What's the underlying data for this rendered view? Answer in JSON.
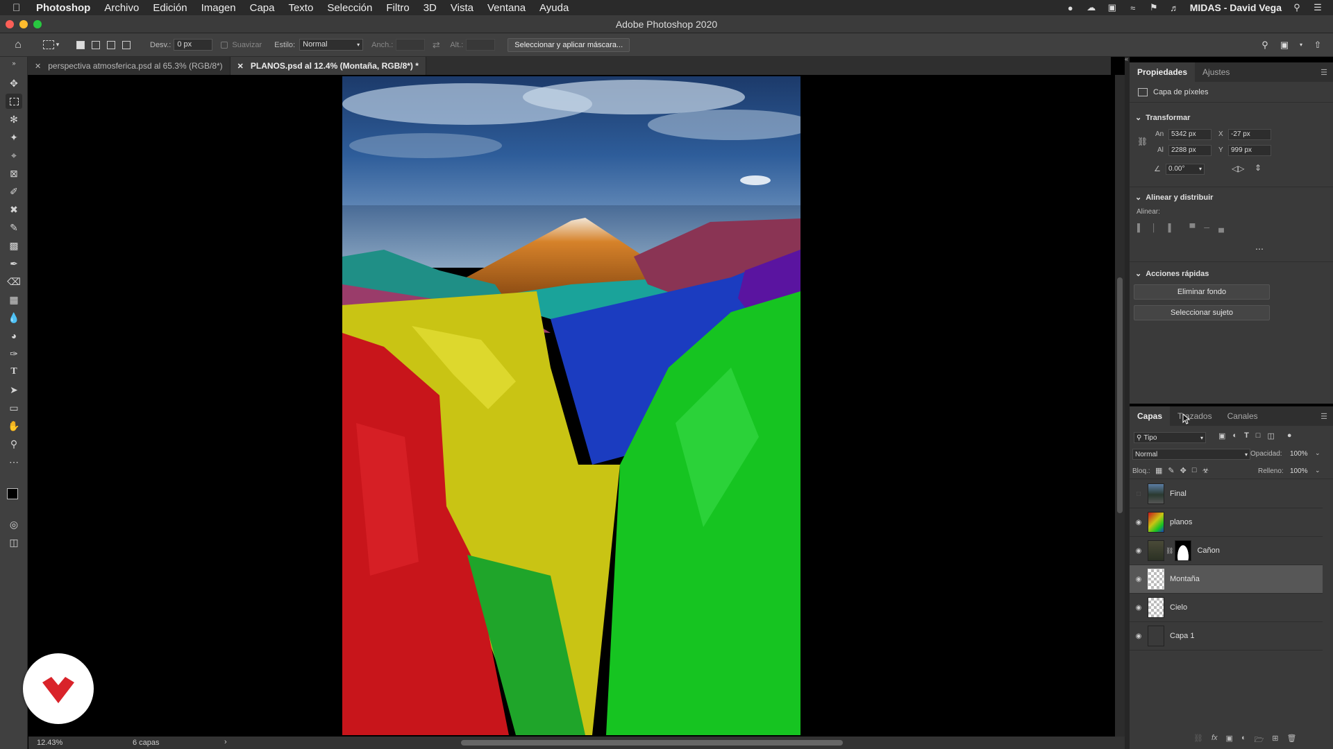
{
  "menubar": {
    "app": "Photoshop",
    "items": [
      "Archivo",
      "Edición",
      "Imagen",
      "Capa",
      "Texto",
      "Selección",
      "Filtro",
      "3D",
      "Vista",
      "Ventana",
      "Ayuda"
    ],
    "user": "MIDAS - David Vega"
  },
  "window": {
    "title": "Adobe Photoshop 2020"
  },
  "options": {
    "desv_label": "Desv.:",
    "desv_value": "0 px",
    "suavizar_label": "Suavizar",
    "estilo_label": "Estilo:",
    "estilo_value": "Normal",
    "anch_label": "Anch.:",
    "alt_label": "Alt.:",
    "mask_button": "Seleccionar y aplicar máscara..."
  },
  "tabs": [
    {
      "label": "perspectiva atmosferica.psd al 65.3% (RGB/8*)"
    },
    {
      "label": "PLANOS.psd al 12.4% (Montaña, RGB/8*) *"
    }
  ],
  "status": {
    "zoom": "12.43%",
    "info": "6 capas"
  },
  "properties": {
    "tabs": [
      "Propiedades",
      "Ajustes"
    ],
    "layer_kind": "Capa de píxeles",
    "transform_title": "Transformar",
    "an_label": "An",
    "an_value": "5342 px",
    "x_label": "X",
    "x_value": "-27 px",
    "al_label": "Al",
    "al_value": "2288 px",
    "y_label": "Y",
    "y_value": "999 px",
    "angle_value": "0.00°",
    "align_title": "Alinear y distribuir",
    "align_label": "Alinear:",
    "quick_title": "Acciones rápidas",
    "remove_bg": "Eliminar fondo",
    "select_subject": "Seleccionar sujeto"
  },
  "layers_panel": {
    "tabs": [
      "Capas",
      "Trazados",
      "Canales"
    ],
    "filter_value": "Tipo",
    "blend_mode": "Normal",
    "opacity_label": "Opacidad:",
    "opacity_value": "100%",
    "lock_label": "Bloq.:",
    "fill_label": "Relleno:",
    "fill_value": "100%",
    "layers": [
      {
        "name": "Final",
        "visible": false
      },
      {
        "name": "planos",
        "visible": true
      },
      {
        "name": "Cañon",
        "visible": true
      },
      {
        "name": "Montaña",
        "visible": true,
        "selected": true
      },
      {
        "name": "Cielo",
        "visible": true
      },
      {
        "name": "Capa 1",
        "visible": true
      }
    ]
  },
  "colors": {
    "accent_red": "#d9232a",
    "panel_bg": "#3a3a3a"
  }
}
